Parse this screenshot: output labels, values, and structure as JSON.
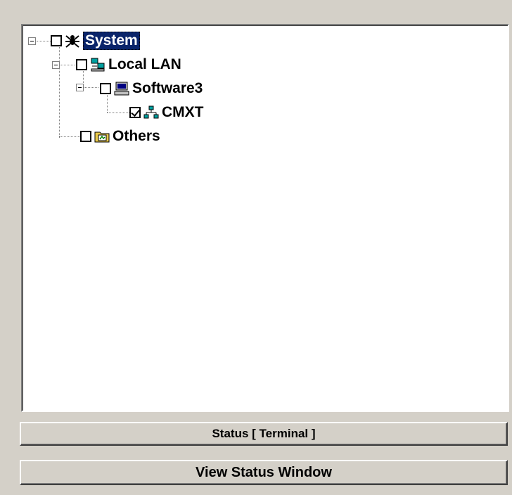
{
  "tree": {
    "nodes": [
      {
        "label": "System",
        "checked": false,
        "icon": "spider-icon",
        "selected": true
      },
      {
        "label": "Local LAN",
        "checked": false,
        "icon": "lan-icon",
        "selected": false
      },
      {
        "label": "Software3",
        "checked": false,
        "icon": "computer-icon",
        "selected": false
      },
      {
        "label": "CMXT",
        "checked": true,
        "icon": "network-icon",
        "selected": false
      },
      {
        "label": "Others",
        "checked": false,
        "icon": "folder-icon",
        "selected": false
      }
    ]
  },
  "buttons": {
    "status_label": "Status  [ Terminal ]",
    "view_status_label": "View Status Window"
  },
  "colors": {
    "face": "#d4d0c8",
    "selection": "#0a246a"
  }
}
